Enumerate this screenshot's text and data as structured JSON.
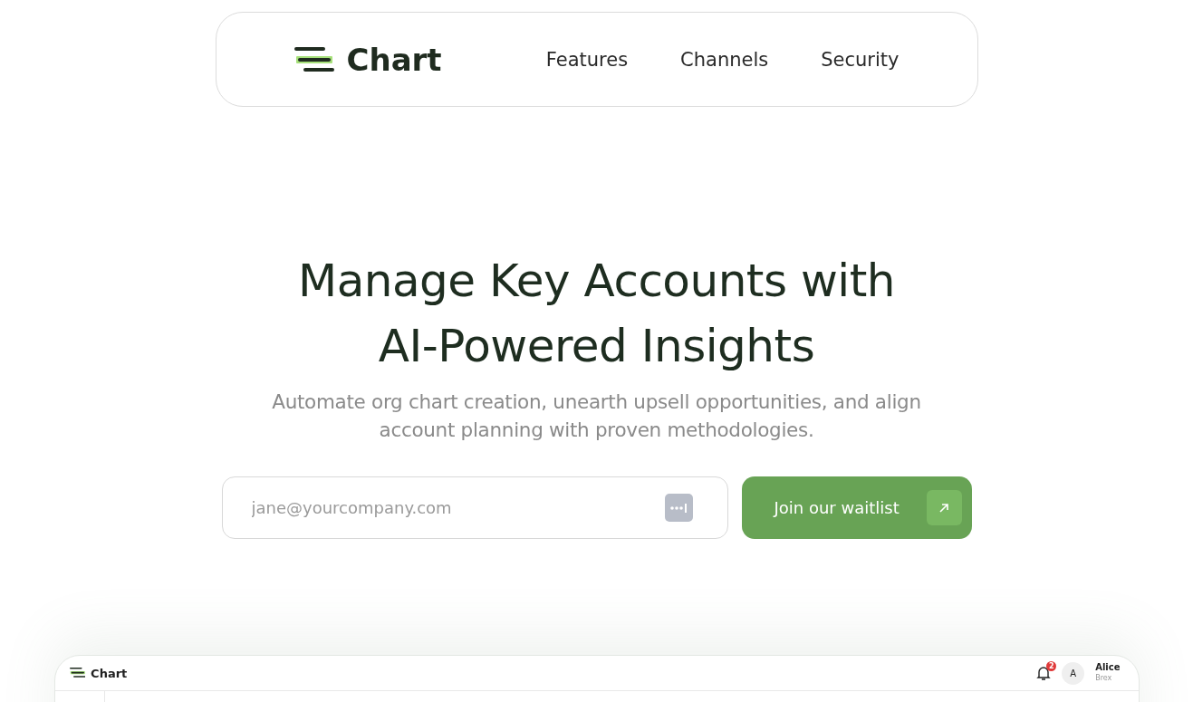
{
  "nav": {
    "brand": "Chart",
    "links": [
      "Features",
      "Channels",
      "Security"
    ]
  },
  "hero": {
    "title_lines": [
      "Manage Key Accounts with",
      "AI-Powered Insights"
    ],
    "subtitle_lines": [
      "Automate org chart creation, unearth upsell opportunities, and align",
      "account planning with proven methodologies."
    ]
  },
  "signup": {
    "placeholder": "jane@yourcompany.com",
    "button": "Join our waitlist"
  },
  "preview": {
    "brand": "Chart",
    "notifications": "2",
    "user": {
      "initial": "A",
      "name": "Alice",
      "company": "Brex"
    }
  }
}
